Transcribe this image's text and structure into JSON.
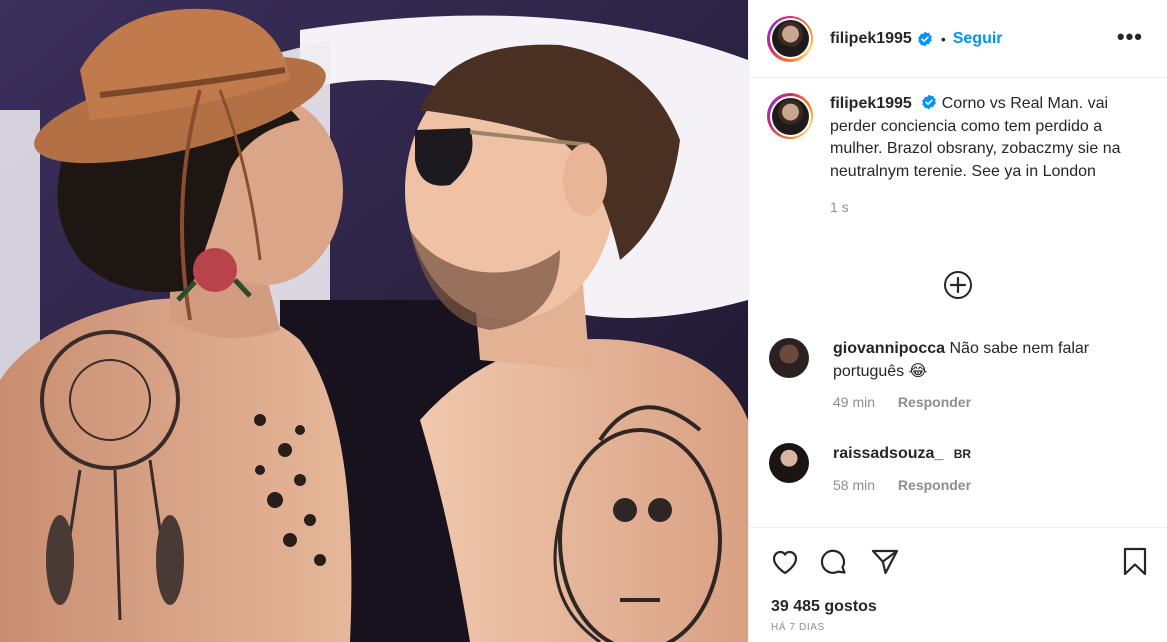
{
  "post": {
    "author": "filipek1995",
    "verified": true,
    "separator": "•",
    "follow_label": "Seguir",
    "more_label": "•••",
    "caption": "Corno vs Real Man. vai perder conciencia como tem perdido a mulher. Brazol obsrany, zobaczmy sie na neutralnym terenie. See ya in London",
    "caption_time": "1 s",
    "likes": "39 485 gostos",
    "posted_ago": "HÁ 7 DIAS"
  },
  "comments": [
    {
      "user": "giovannipocca",
      "text": "Não sabe nem falar português 😂",
      "time": "49 min",
      "reply_label": "Responder"
    },
    {
      "user": "raissadsouza_",
      "badge": "BR",
      "text": "",
      "time": "58 min",
      "reply_label": "Responder"
    }
  ],
  "icons": {
    "verified": "verified-badge-icon",
    "load_more": "plus-circle-icon",
    "like": "heart-icon",
    "comment": "comment-bubble-icon",
    "share": "paper-plane-icon",
    "save": "bookmark-icon"
  },
  "colors": {
    "link_blue": "#0095f6",
    "text": "#262626",
    "muted": "#8e8e8e",
    "border": "#efefef"
  }
}
